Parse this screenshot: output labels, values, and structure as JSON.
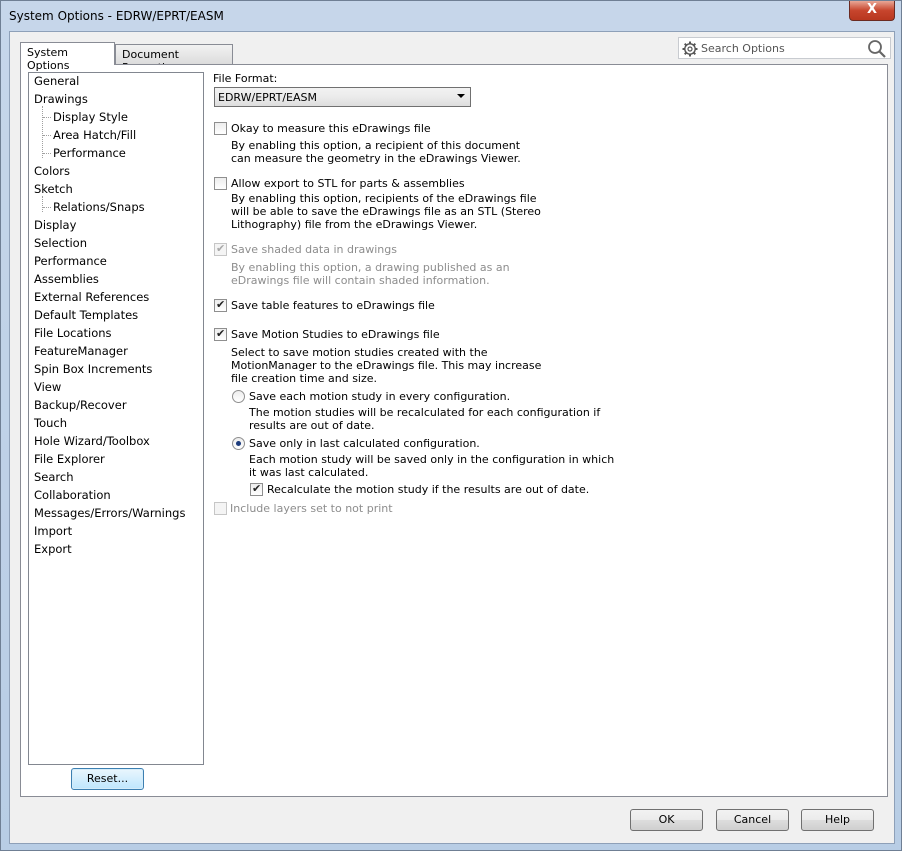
{
  "window": {
    "title": "System Options - EDRW/EPRT/EASM",
    "close_label": "X"
  },
  "tabs": [
    {
      "label": "System Options",
      "active": true
    },
    {
      "label": "Document Properties",
      "active": false
    }
  ],
  "search": {
    "placeholder": "Search Options"
  },
  "tree": {
    "items": [
      {
        "label": "General",
        "level": 0
      },
      {
        "label": "Drawings",
        "level": 0
      },
      {
        "label": "Display Style",
        "level": 1
      },
      {
        "label": "Area Hatch/Fill",
        "level": 1
      },
      {
        "label": "Performance",
        "level": 1
      },
      {
        "label": "Colors",
        "level": 0
      },
      {
        "label": "Sketch",
        "level": 0
      },
      {
        "label": "Relations/Snaps",
        "level": 1
      },
      {
        "label": "Display",
        "level": 0
      },
      {
        "label": "Selection",
        "level": 0
      },
      {
        "label": "Performance",
        "level": 0
      },
      {
        "label": "Assemblies",
        "level": 0
      },
      {
        "label": "External References",
        "level": 0
      },
      {
        "label": "Default Templates",
        "level": 0
      },
      {
        "label": "File Locations",
        "level": 0
      },
      {
        "label": "FeatureManager",
        "level": 0
      },
      {
        "label": "Spin Box Increments",
        "level": 0
      },
      {
        "label": "View",
        "level": 0
      },
      {
        "label": "Backup/Recover",
        "level": 0
      },
      {
        "label": "Touch",
        "level": 0
      },
      {
        "label": "Hole Wizard/Toolbox",
        "level": 0
      },
      {
        "label": "File Explorer",
        "level": 0
      },
      {
        "label": "Search",
        "level": 0
      },
      {
        "label": "Collaboration",
        "level": 0
      },
      {
        "label": "Messages/Errors/Warnings",
        "level": 0
      },
      {
        "label": "Import",
        "level": 0
      },
      {
        "label": "Export",
        "level": 0
      }
    ]
  },
  "reset_label": "Reset...",
  "options": {
    "file_format_label": "File Format:",
    "file_format_value": "EDRW/EPRT/EASM",
    "measure": {
      "label": "Okay to measure this eDrawings file",
      "checked": false,
      "desc1": "By enabling this option, a recipient of this document",
      "desc2": "can measure the geometry in the eDrawings Viewer."
    },
    "stl": {
      "label": "Allow export to STL for parts & assemblies",
      "checked": false,
      "desc1": "By enabling this option, recipients of the eDrawings file",
      "desc2": "will be able to save the eDrawings file as an STL (Stereo",
      "desc3": "Lithography) file from the eDrawings Viewer."
    },
    "shaded": {
      "label": "Save shaded data in drawings",
      "checked": true,
      "disabled": true,
      "desc1": "By enabling this option, a drawing published as an",
      "desc2": "eDrawings file will contain shaded information."
    },
    "table": {
      "label": "Save table features to eDrawings file",
      "checked": true
    },
    "motion": {
      "label": "Save Motion Studies to eDrawings file",
      "checked": true,
      "desc1": "Select to save motion studies created with the",
      "desc2": "MotionManager to the eDrawings file.  This may increase",
      "desc3": "file creation time and size."
    },
    "every_config": {
      "label": "Save each motion study in every configuration.",
      "checked": false,
      "desc1": "The motion studies will be recalculated for each configuration if",
      "desc2": "results are out of date."
    },
    "last_config": {
      "label": "Save only in last calculated configuration.",
      "checked": true,
      "desc1": "Each motion study will be saved only in the configuration in which",
      "desc2": "it was last calculated."
    },
    "recalc": {
      "label": "Recalculate the motion study if the results are out of date.",
      "checked": true
    },
    "layers": {
      "label": "Include layers set to not print",
      "checked": false,
      "disabled": true
    }
  },
  "buttons": {
    "ok": "OK",
    "cancel": "Cancel",
    "help": "Help"
  }
}
